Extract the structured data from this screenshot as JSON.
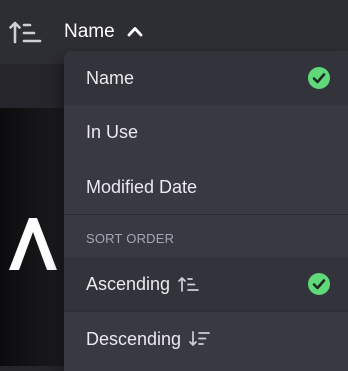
{
  "topbar": {
    "sort_icon": "sort-ascending-icon",
    "sort_label": "Name",
    "chevron_icon": "chevron-up-icon"
  },
  "menu": {
    "sort_by_items": [
      {
        "label": "Name",
        "selected": true
      },
      {
        "label": "In Use",
        "selected": false
      },
      {
        "label": "Modified Date",
        "selected": false
      }
    ],
    "sort_order_header": "SORT ORDER",
    "sort_order_items": [
      {
        "label": "Ascending",
        "icon": "sort-ascending-icon",
        "selected": true
      },
      {
        "label": "Descending",
        "icon": "sort-descending-icon",
        "selected": false
      }
    ]
  },
  "colors": {
    "check": "#5fd97a",
    "menu_bg": "#393944",
    "selected_bg": "#33333c",
    "topbar_bg": "#2d2d34",
    "section_text": "#a6a6b2"
  }
}
